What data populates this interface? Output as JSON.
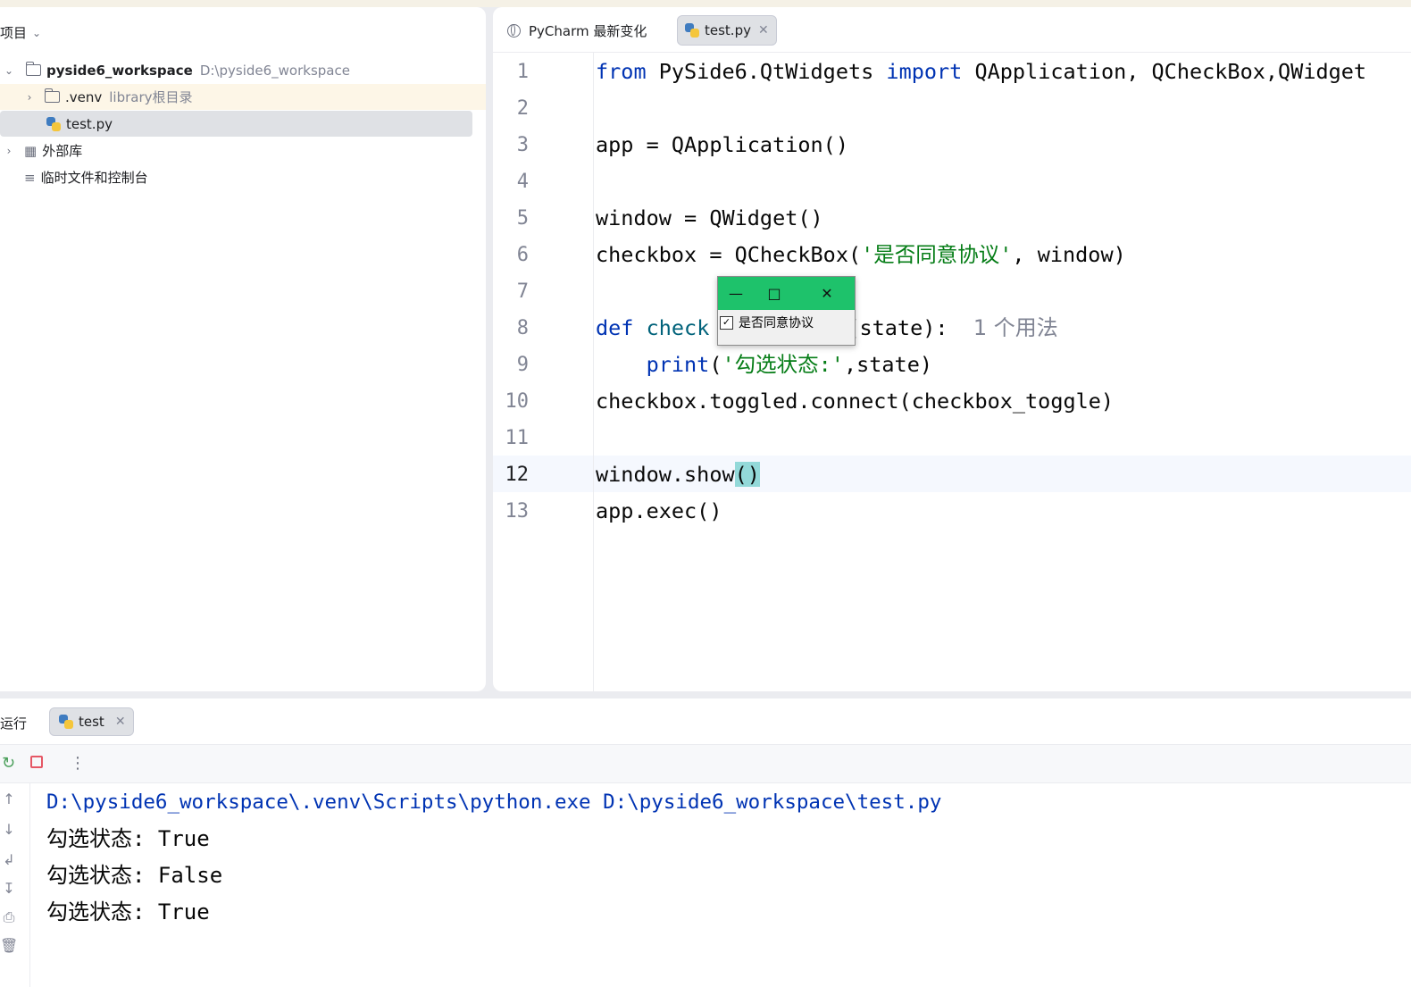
{
  "project_panel": {
    "title": "项目",
    "root_name": "pyside6_workspace",
    "root_path": "D:\\pyside6_workspace",
    "venv_name": ".venv",
    "venv_note": "library根目录",
    "file_name": "test.py",
    "external_libs": "外部库",
    "scratches": "临时文件和控制台"
  },
  "editor": {
    "tabs": [
      {
        "label": "PyCharm 最新变化",
        "icon": "globe-icon"
      },
      {
        "label": "test.py",
        "icon": "python-icon",
        "active": true
      }
    ],
    "current_line": 12,
    "line_numbers": [
      "1",
      "2",
      "3",
      "4",
      "5",
      "6",
      "7",
      "8",
      "9",
      "10",
      "11",
      "12",
      "13"
    ],
    "lines": {
      "l1": {
        "from": "from",
        "mid": " PySide6.QtWidgets ",
        "import": "import",
        "rest": " QApplication, QCheckBox,QWidget"
      },
      "l3": "app = QApplication()",
      "l5": "window = QWidget()",
      "l6": {
        "a": "checkbox = QCheckBox(",
        "s": "'是否同意协议'",
        "b": ", window)"
      },
      "l8": {
        "def": "def",
        "name": " check",
        "rest": "(state):",
        "hint": "1 个用法"
      },
      "l9": {
        "print": "print",
        "p": "(",
        "s": "'勾选状态:'",
        "rest": ",state)"
      },
      "l10": "checkbox.toggled.connect(checkbox_toggle)",
      "l12": {
        "a": "window.show",
        "b": "()"
      },
      "l13": "app.exec()"
    }
  },
  "qt_window": {
    "checkbox_label": "是否同意协议",
    "checked": true,
    "titlebar_color": "#1ec26b"
  },
  "run_panel": {
    "label": "运行",
    "tab_label": "test",
    "output": [
      "D:\\pyside6_workspace\\.venv\\Scripts\\python.exe D:\\pyside6_workspace\\test.py",
      "勾选状态: True",
      "勾选状态: False",
      "勾选状态: True"
    ]
  }
}
